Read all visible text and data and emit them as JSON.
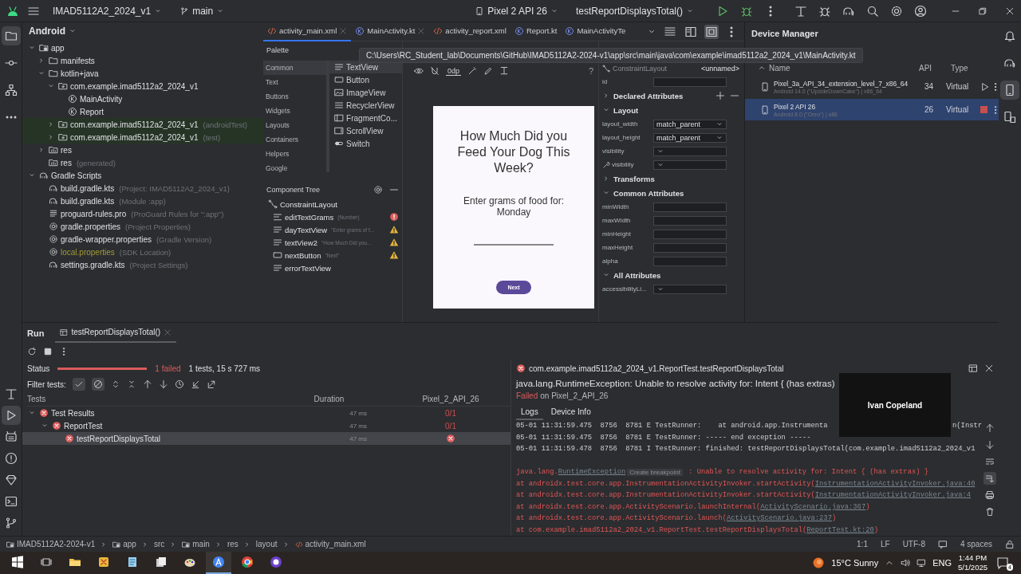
{
  "title_bar": {
    "project": "IMAD5112A2_2024_v1",
    "branch": "main",
    "device": "Pixel 2 API 26",
    "run_config": "testReportDisplaysTotal()"
  },
  "left_strip": {
    "top": [
      {
        "kind": "project",
        "selected": true
      },
      {
        "kind": "commit",
        "selected": false
      },
      {
        "kind": "structure",
        "selected": false
      },
      {
        "kind": "more",
        "selected": false
      }
    ],
    "bottom": [
      {
        "kind": "build",
        "selected": false
      },
      {
        "kind": "run",
        "selected": true
      },
      {
        "kind": "logcat",
        "selected": false
      },
      {
        "kind": "problems",
        "selected": false
      },
      {
        "kind": "gem",
        "selected": false
      },
      {
        "kind": "terminal",
        "selected": false
      },
      {
        "kind": "git",
        "selected": false
      }
    ]
  },
  "right_strip": [
    {
      "kind": "notifications",
      "selected": false
    },
    {
      "kind": "gradle",
      "selected": false
    },
    {
      "kind": "device-manager",
      "selected": true
    },
    {
      "kind": "mirroring",
      "selected": false
    }
  ],
  "project": {
    "view": "Android",
    "tree": [
      {
        "label": "app",
        "kind": "module",
        "expanded": true,
        "children": [
          {
            "label": "manifests",
            "kind": "folder",
            "expanded": false
          },
          {
            "label": "kotlin+java",
            "kind": "folder",
            "expanded": true,
            "children": [
              {
                "label": "com.example.imad5112a2_2024_v1",
                "kind": "package",
                "expanded": true,
                "highlighted": false,
                "children": [
                  {
                    "label": "MainActivity",
                    "kind": "class"
                  },
                  {
                    "label": "Report",
                    "kind": "class"
                  }
                ]
              },
              {
                "label": "com.example.imad5112a2_2024_v1",
                "hint": "(androidTest)",
                "kind": "package",
                "expanded": false,
                "highlighted": true
              },
              {
                "label": "com.example.imad5112a2_2024_v1",
                "hint": "(test)",
                "kind": "package",
                "expanded": false,
                "highlighted": true
              }
            ]
          },
          {
            "label": "res",
            "kind": "res",
            "expanded": false
          },
          {
            "label": "res",
            "hint": "(generated)",
            "kind": "res"
          }
        ]
      },
      {
        "label": "Gradle Scripts",
        "kind": "gradle",
        "expanded": true,
        "children": [
          {
            "label": "build.gradle.kts",
            "hint": "(Project: IMAD5112A2_2024_v1)",
            "kind": "gradle",
            "ignored": false
          },
          {
            "label": "build.gradle.kts",
            "hint": "(Module :app)",
            "kind": "gradle",
            "ignored": false
          },
          {
            "label": "proguard-rules.pro",
            "hint": "(ProGuard Rules for \":app\")",
            "kind": "file",
            "ignored": false
          },
          {
            "label": "gradle.properties",
            "hint": "(Project Properties)",
            "kind": "settings",
            "ignored": false
          },
          {
            "label": "gradle-wrapper.properties",
            "hint": "(Gradle Version)",
            "kind": "settings",
            "ignored": false
          },
          {
            "label": "local.properties",
            "hint": "(SDK Location)",
            "kind": "settings",
            "ignored": true
          },
          {
            "label": "settings.gradle.kts",
            "hint": "(Project Settings)",
            "kind": "gradle",
            "ignored": false
          }
        ]
      }
    ]
  },
  "editor": {
    "tabs": [
      {
        "label": "activity_main.xml",
        "kind": "xml",
        "selected": true,
        "closable": true
      },
      {
        "label": "MainActivity.kt",
        "kind": "kotlin",
        "selected": false,
        "closable": true
      },
      {
        "label": "activity_report.xml",
        "kind": "xml",
        "selected": false,
        "closable": false
      },
      {
        "label": "Report.kt",
        "kind": "kotlin",
        "selected": false,
        "closable": false
      },
      {
        "label": "MainActivityTe",
        "kind": "kotlin",
        "selected": false,
        "closable": false
      }
    ],
    "view_modes": [
      {
        "kind": "code",
        "selected": false
      },
      {
        "kind": "split",
        "selected": false
      },
      {
        "kind": "design",
        "selected": true
      }
    ],
    "tooltip": "C:\\Users\\RC_Student_lab\\Documents\\GitHub\\IMAD5112A2-2024-v1\\app\\src\\main\\java\\com\\example\\imad5112a2_2024_v1\\MainActivity.kt",
    "palette": {
      "title": "Palette",
      "categories": [
        {
          "label": "Common",
          "selected": true
        },
        {
          "label": "Text",
          "selected": false
        },
        {
          "label": "Buttons",
          "selected": false
        },
        {
          "label": "Widgets",
          "selected": false
        },
        {
          "label": "Layouts",
          "selected": false
        },
        {
          "label": "Containers",
          "selected": false
        },
        {
          "label": "Helpers",
          "selected": false
        },
        {
          "label": "Google",
          "selected": false
        }
      ],
      "items": [
        {
          "label": "TextView",
          "kind": "text",
          "selected": true
        },
        {
          "label": "Button",
          "kind": "button",
          "selected": false
        },
        {
          "label": "ImageView",
          "kind": "image",
          "selected": false
        },
        {
          "label": "RecyclerView",
          "kind": "list",
          "selected": false
        },
        {
          "label": "FragmentCo...",
          "kind": "fragment",
          "selected": false
        },
        {
          "label": "ScrollView",
          "kind": "scroll",
          "selected": false
        },
        {
          "label": "Switch",
          "kind": "switch",
          "selected": false
        }
      ]
    },
    "component_tree": {
      "title": "Component Tree",
      "root": "ConstraintLayout",
      "children": [
        {
          "label": "editTextGrams",
          "hint": "(Number)",
          "kind": "edit",
          "error": true,
          "warning": false
        },
        {
          "label": "dayTextView",
          "hint": "\"Enter grams of f...",
          "kind": "text",
          "error": false,
          "warning": true
        },
        {
          "label": "textView2",
          "hint": "\"How Much Did you...",
          "kind": "text",
          "error": false,
          "warning": true
        },
        {
          "label": "nextButton",
          "hint": "\"Next\"",
          "kind": "button",
          "error": false,
          "warning": true
        },
        {
          "label": "errorTextView",
          "kind": "text",
          "error": false,
          "warning": false
        }
      ]
    },
    "design_toolbar": {
      "margin": "0dp",
      "help": "?"
    },
    "preview": {
      "title": "How Much Did you Feed Your Dog This Week?",
      "prompt": "Enter grams of food for: Monday",
      "button": "Next"
    },
    "attributes": {
      "component": "ConstraintLayout",
      "id_value": "<unnamed>",
      "rows": [
        {
          "kind": "field",
          "label": "id"
        },
        {
          "kind": "section",
          "label": "Declared Attributes",
          "expanded": false
        },
        {
          "kind": "section",
          "label": "Layout",
          "expanded": true
        },
        {
          "kind": "dropdown",
          "label": "layout_width",
          "value": "match_parent"
        },
        {
          "kind": "dropdown",
          "label": "layout_height",
          "value": "match_parent"
        },
        {
          "kind": "dropdown",
          "label": "visibility"
        },
        {
          "kind": "tool-dropdown",
          "label": "visibility"
        },
        {
          "kind": "section",
          "label": "Transforms",
          "expanded": false
        },
        {
          "kind": "section",
          "label": "Common Attributes",
          "expanded": true
        },
        {
          "kind": "field",
          "label": "minWidth"
        },
        {
          "kind": "field",
          "label": "maxWidth"
        },
        {
          "kind": "field",
          "label": "minHeight"
        },
        {
          "kind": "field",
          "label": "maxHeight"
        },
        {
          "kind": "field",
          "label": "alpha"
        },
        {
          "kind": "section",
          "label": "All Attributes",
          "expanded": true
        },
        {
          "kind": "dropdown",
          "label": "accessibilityLi..."
        }
      ]
    }
  },
  "device_manager": {
    "title": "Device Manager",
    "columns": [
      "Name",
      "API",
      "Type"
    ],
    "devices": [
      {
        "name": "Pixel_3a_API_34_extension_level_7_x86_64",
        "detail": "Android 14.0 (\"UpsideDownCake\") | x86_64",
        "api": "34",
        "type": "Virtual",
        "running": false,
        "selected": false
      },
      {
        "name": "Pixel 2 API 26",
        "detail": "Android 8.0 (\"Oreo\") | x86",
        "api": "26",
        "type": "Virtual",
        "running": true,
        "selected": true
      }
    ]
  },
  "run": {
    "title": "Run",
    "tabs": [
      {
        "label": "testReportDisplaysTotal()",
        "selected": true
      }
    ],
    "status": {
      "label": "Status",
      "level": 1,
      "failed": "1 failed",
      "summary": "1 tests, 15 s 727 ms"
    },
    "filter": {
      "label": "Filter tests:",
      "show_passed": true,
      "show_ignored": true
    },
    "table": {
      "columns": [
        "Tests",
        "Duration",
        "Pixel_2_API_26"
      ],
      "rows": [
        {
          "label": "Test Results",
          "duration": "47 ms",
          "result": "0/1",
          "expanded": true,
          "selected": false,
          "children": [
            {
              "label": "ReportTest",
              "duration": "47 ms",
              "result": "0/1",
              "expanded": true,
              "selected": false,
              "children": [
                {
                  "label": "testReportDisplaysTotal",
                  "duration": "47 ms",
                  "selected": true
                }
              ]
            }
          ]
        }
      ]
    },
    "detail": {
      "title": "com.example.imad5112a2_2024_v1.ReportTest.testReportDisplaysTotal",
      "exception": "java.lang.RuntimeException: Unable to resolve activity for: Intent { (has extras)",
      "status": "Failed",
      "device": "on Pixel_2_API_26",
      "tabs": [
        {
          "label": "Logs",
          "selected": true
        },
        {
          "label": "Device Info",
          "selected": false
        }
      ],
      "log": [
        {
          "kind": "info",
          "parts": [
            {
              "kind": "text",
              "text": "05-01 11:31:59.475  8756  8781 E TestRunner:    at android.app.Instrumenta"
            }
          ],
          "tail": "n(Instr"
        },
        {
          "kind": "info",
          "parts": [
            {
              "kind": "text",
              "text": "05-01 11:31:59.475  8756  8781 E TestRunner: ----- end exception -----"
            }
          ]
        },
        {
          "kind": "info",
          "parts": [
            {
              "kind": "text",
              "text": "05-01 11:31:59.478  8756  8781 I TestRunner: finished: testReportDisplaysTotal(com.example.imad5112a2_2024_v1"
            }
          ]
        },
        {
          "kind": "blank"
        },
        {
          "kind": "error",
          "parts": [
            {
              "kind": "text",
              "text": "java.lang."
            },
            {
              "kind": "link",
              "text": "RuntimeException"
            },
            {
              "kind": "chip",
              "text": "Create breakpoint"
            },
            {
              "kind": "text",
              "text": " : Unable to resolve activity for: Intent { (has extras) }"
            }
          ]
        },
        {
          "kind": "error",
          "parts": [
            {
              "kind": "text",
              "text": "at androidx.test.core.app.InstrumentationActivityInvoker.startActivity("
            },
            {
              "kind": "link",
              "text": "InstrumentationActivityInvoker.java:40"
            }
          ]
        },
        {
          "kind": "error",
          "parts": [
            {
              "kind": "text",
              "text": "at androidx.test.core.app.InstrumentationActivityInvoker.startActivity("
            },
            {
              "kind": "link",
              "text": "InstrumentationActivityInvoker.java:4"
            }
          ]
        },
        {
          "kind": "error",
          "parts": [
            {
              "kind": "text",
              "text": "at androidx.test.core.app.ActivityScenario.launchInternal("
            },
            {
              "kind": "link",
              "text": "ActivityScenario.java:367"
            },
            {
              "kind": "text",
              "text": ")"
            }
          ]
        },
        {
          "kind": "error",
          "parts": [
            {
              "kind": "text",
              "text": "at androidx.test.core.app.ActivityScenario.launch("
            },
            {
              "kind": "link",
              "text": "ActivityScenario.java:237"
            },
            {
              "kind": "text",
              "text": ")"
            }
          ]
        },
        {
          "kind": "error",
          "parts": [
            {
              "kind": "text",
              "text": "at com.example.imad5112a2_2024_v1.ReportTest.testReportDisplaysTotal("
            },
            {
              "kind": "link",
              "text": "ReportTest.kt:20"
            },
            {
              "kind": "text",
              "text": ")"
            }
          ]
        }
      ],
      "log_tools": [
        {
          "kind": "up",
          "selected": false
        },
        {
          "kind": "down",
          "selected": false
        },
        {
          "kind": "wrap",
          "selected": false
        },
        {
          "kind": "scrollend",
          "selected": true
        },
        {
          "kind": "print",
          "selected": false
        },
        {
          "kind": "trash",
          "selected": false
        }
      ]
    }
  },
  "overlay": {
    "name": "Ivan Copeland"
  },
  "status_bar": {
    "breadcrumb": [
      "IMAD5112A2-2024-v1",
      "app",
      "src",
      "main",
      "res",
      "layout",
      "activity_main.xml"
    ],
    "position": "1:1",
    "line_ending": "LF",
    "encoding": "UTF-8",
    "indent": "4 spaces"
  },
  "taskbar": {
    "apps": [
      {
        "kind": "folder",
        "active": false
      },
      {
        "kind": "tool",
        "active": false
      },
      {
        "kind": "notepad",
        "active": false
      },
      {
        "kind": "cards",
        "active": false
      },
      {
        "kind": "paint",
        "active": false
      },
      {
        "kind": "studio",
        "active": true
      },
      {
        "kind": "browser",
        "active": false
      },
      {
        "kind": "octocat",
        "active": false
      }
    ],
    "weather": "15°C Sunny",
    "language": "ENG",
    "time": "1:44 PM",
    "date": "5/1/2025",
    "notifications": "4"
  }
}
